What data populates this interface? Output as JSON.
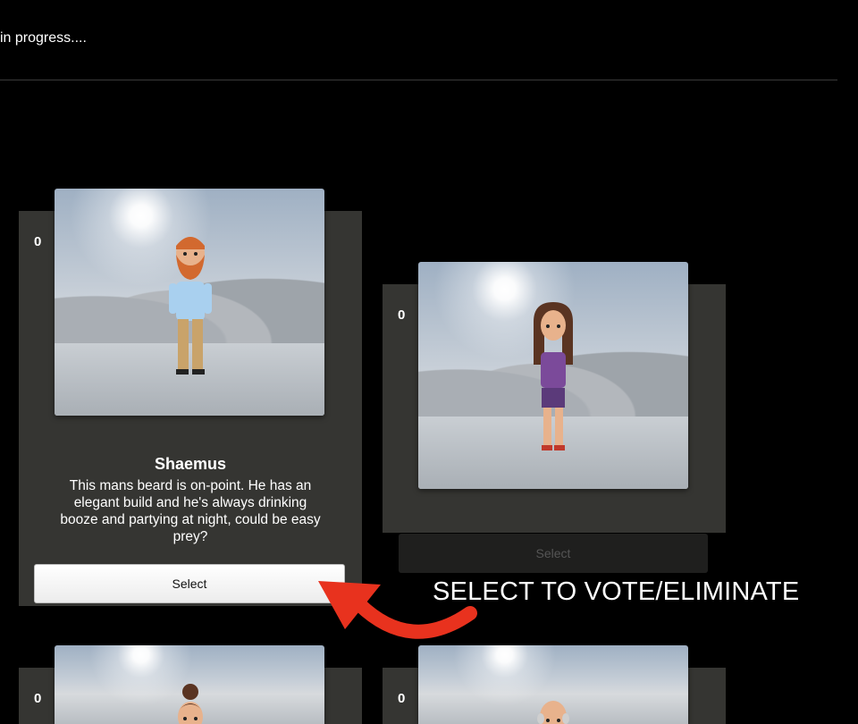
{
  "header": {
    "status_text": "in progress...."
  },
  "cards": [
    {
      "count": "0",
      "name": "Shaemus",
      "description": "This mans beard is on-point. He has an elegant build and he's always drinking booze and partying at night, could be easy prey?",
      "select_label": "Select"
    },
    {
      "count": "0",
      "name": "",
      "description": "",
      "select_label": "Select"
    },
    {
      "count": "0"
    },
    {
      "count": "0"
    }
  ],
  "annotation": {
    "text": "SELECT TO VOTE/ELIMINATE",
    "color": "#e8321e"
  },
  "colors": {
    "background": "#000000",
    "card": "#353532",
    "accent_arrow": "#e8321e"
  },
  "icons": [
    "character-man-beard",
    "character-woman-purple",
    "character-woman-bun",
    "character-man-bald",
    "curved-arrow-icon"
  ]
}
